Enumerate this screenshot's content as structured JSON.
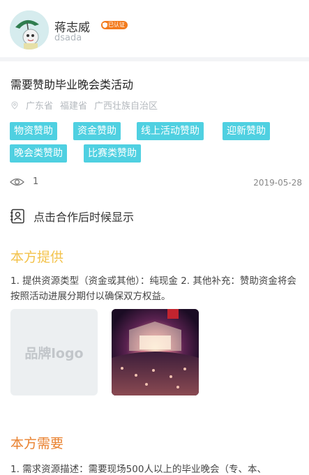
{
  "profile": {
    "name": "蒋志威",
    "id": "dsada",
    "verified_label": "已认证",
    "avatar_icon": "avatar-cartoon"
  },
  "activity": {
    "title": "需要赞助毕业晚会类活动",
    "regions": [
      "广东省",
      "福建省",
      "广西壮族自治区"
    ],
    "tags": [
      "物资赞助",
      "资金赞助",
      "线上活动赞助",
      "迎新赞助",
      "晚会类赞助",
      "比赛类赞助"
    ],
    "views": "1",
    "date": "2019-05-28"
  },
  "contact": {
    "label": "点击合作后时候显示",
    "icon": "contact-card-icon"
  },
  "provide": {
    "heading": "本方提供",
    "text": "1. 提供资源类型（资金或其他）：纯现金 2. 其他补充：赞助资金将会按照活动进展分期付以确保双方权益。",
    "brand_placeholder": "品牌logo"
  },
  "need": {
    "heading": "本方需要",
    "text": "1. 需求资源描述：需要现场500人以上的毕业晚会（专、本、"
  },
  "colors": {
    "tag_bg": "#4fd0e1",
    "provide_heading": "#f3c24a",
    "need_heading": "#e9812f",
    "verified_badge": "#f37b1d"
  }
}
